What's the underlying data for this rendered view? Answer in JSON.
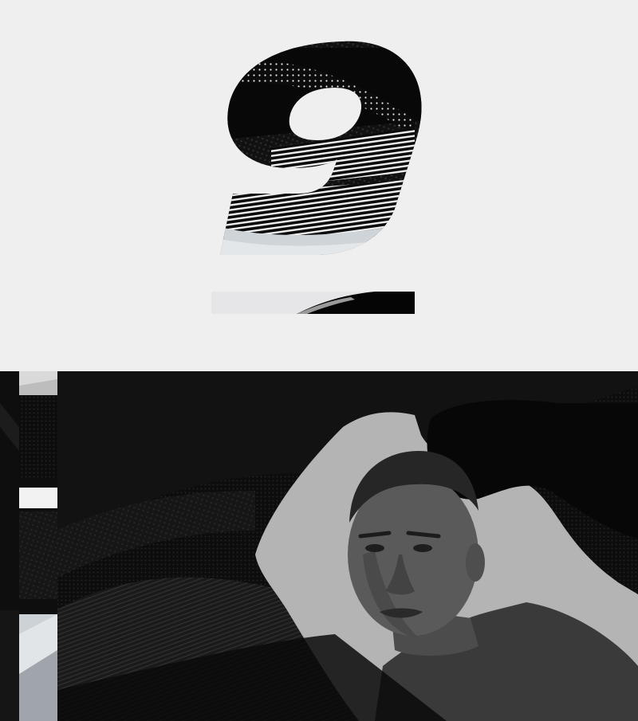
{
  "number_graphic": {
    "numeral": "9"
  },
  "colors": {
    "background_light": "#efefef",
    "background_dark": "#121212",
    "knit_black": "#0a0a0a",
    "knit_gray": "#2a2a2a",
    "portrait_gray": "#b4b4b4"
  },
  "icons": {
    "numeral_mark": "numeral-nine-icon",
    "underline_bar": "underline-bar-icon",
    "side_strip": "vertical-letter-strip-icon",
    "portrait": "person-portrait-icon"
  }
}
